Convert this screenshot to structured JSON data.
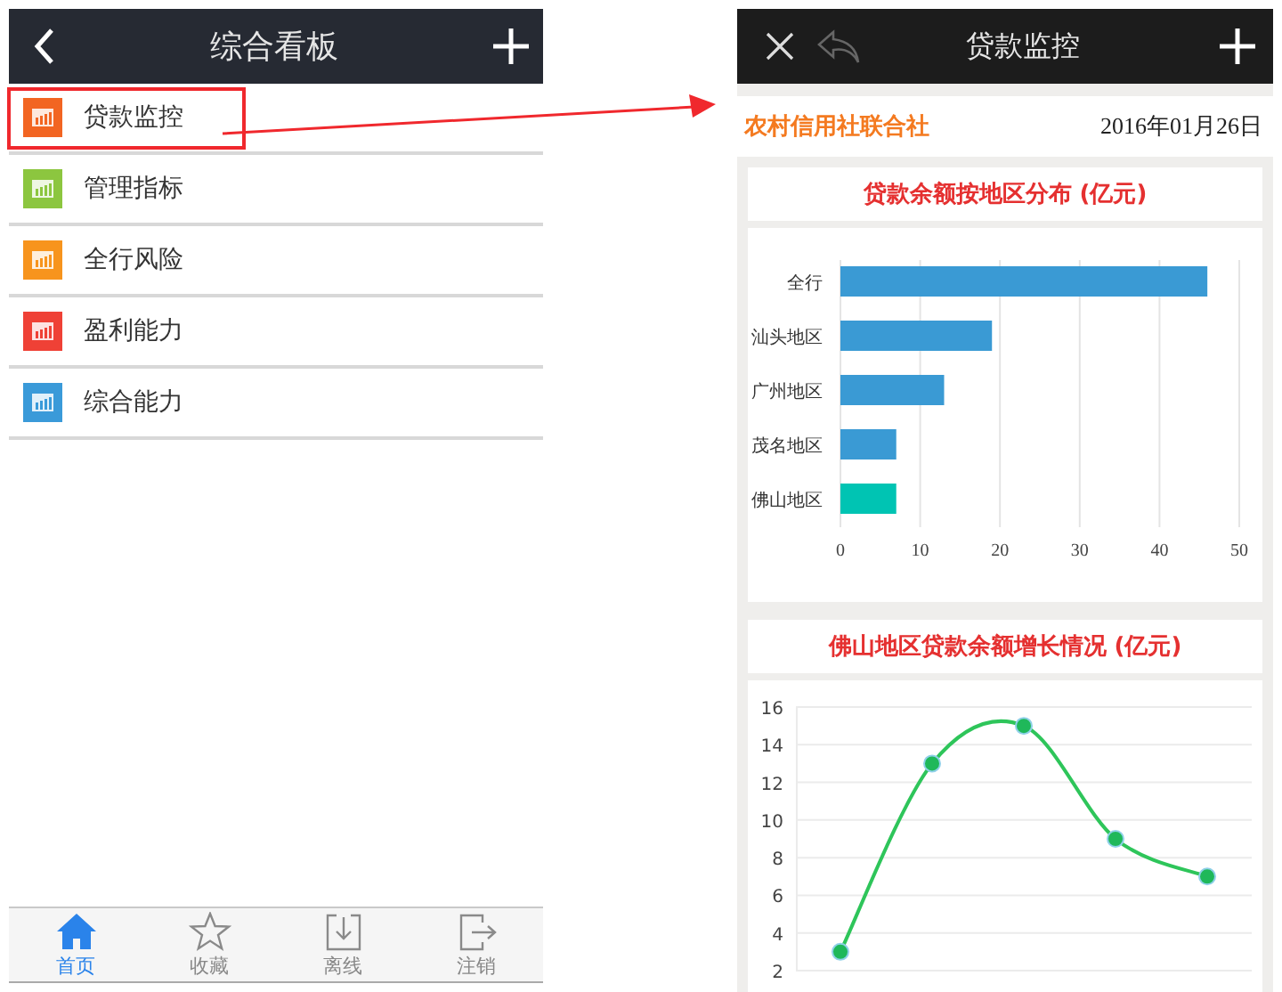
{
  "left_screen": {
    "header": {
      "title": "综合看板"
    },
    "menu": [
      {
        "label": "贷款监控",
        "color": "#f26522",
        "annotated": true
      },
      {
        "label": "管理指标",
        "color": "#8cc63f",
        "annotated": false
      },
      {
        "label": "全行风险",
        "color": "#f7941d",
        "annotated": false
      },
      {
        "label": "盈利能力",
        "color": "#ef4136",
        "annotated": false
      },
      {
        "label": "综合能力",
        "color": "#3a9ad9",
        "annotated": false
      }
    ],
    "tab_bar": [
      {
        "label": "首页",
        "kind": "home",
        "selected": true
      },
      {
        "label": "收藏",
        "kind": "star",
        "selected": false
      },
      {
        "label": "离线",
        "kind": "download",
        "selected": false
      },
      {
        "label": "注销",
        "kind": "logout",
        "selected": false
      }
    ]
  },
  "right_screen": {
    "header": {
      "title": "贷款监控",
      "back_disabled": true
    },
    "organization": "农村信用社联合社",
    "date": "2016年01月26日",
    "cards": [
      {
        "title": "贷款余额按地区分布 (亿元)",
        "chart_data": {
          "type": "bar",
          "orientation": "horizontal",
          "categories": [
            "全行",
            "汕头地区",
            "广州地区",
            "茂名地区",
            "佛山地区"
          ],
          "values": [
            46,
            19,
            13,
            7,
            7
          ],
          "colors": [
            "#3a9ad4",
            "#3a9ad4",
            "#3a9ad4",
            "#3a9ad4",
            "#00c4b3"
          ],
          "xlim": [
            0,
            50
          ],
          "xticks": [
            0,
            10,
            20,
            30,
            40,
            50
          ],
          "grid": true
        }
      },
      {
        "title": "佛山地区贷款余额增长情况 (亿元)",
        "chart_data": {
          "type": "line",
          "series": [
            {
              "color": "#2ec55a",
              "marker": true,
              "values": [
                3,
                13,
                15,
                9,
                7
              ]
            }
          ],
          "ylim": [
            2,
            16
          ],
          "yticks": [
            2,
            4,
            6,
            8,
            10,
            12,
            14,
            16
          ],
          "grid": true
        }
      }
    ]
  }
}
